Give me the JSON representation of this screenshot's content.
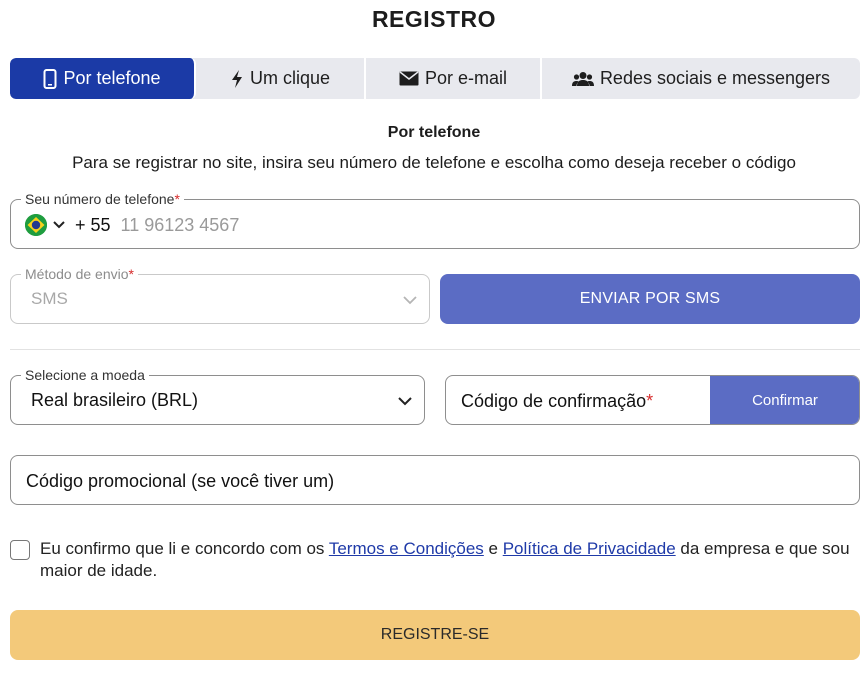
{
  "page": {
    "title": "REGISTRO"
  },
  "tabs": [
    {
      "label": "Por telefone",
      "icon": "phone-icon",
      "active": true
    },
    {
      "label": "Um clique",
      "icon": "lightning-icon"
    },
    {
      "label": "Por e-mail",
      "icon": "envelope-icon"
    },
    {
      "label": "Redes sociais e messengers",
      "icon": "users-icon"
    }
  ],
  "section": {
    "title": "Por telefone",
    "description": "Para se registrar no site, insira seu número de telefone e escolha como deseja receber o código"
  },
  "phone": {
    "label": "Seu número de telefone",
    "required_mark": "*",
    "country_code": "+ 55",
    "placeholder": "11 96123 4567",
    "flag_icon": "brazil-flag-icon"
  },
  "method": {
    "label": "Método de envio",
    "required_mark": "*",
    "value": "SMS"
  },
  "send_button": {
    "label": "ENVIAR POR SMS"
  },
  "currency": {
    "label": "Selecione a moeda",
    "value": "Real brasileiro (BRL)"
  },
  "confirmation": {
    "label": "Código de confirmação",
    "required_mark": "*",
    "button_label": "Confirmar"
  },
  "promo": {
    "label": "Código promocional (se você tiver um)"
  },
  "terms": {
    "text_before": "Eu confirmo que li e concordo com os ",
    "link1": "Termos e Condições",
    "text_between": " e ",
    "link2": "Política de Privacidade",
    "text_after": " da empresa e que sou maior de idade."
  },
  "register_button": {
    "label": "REGISTRE-SE"
  },
  "colors": {
    "active_tab": "#1b3aa6",
    "primary_button": "#5b6cc4",
    "register_button": "#f3c97a",
    "required": "#d62b2b",
    "link": "#1f3aa8"
  }
}
